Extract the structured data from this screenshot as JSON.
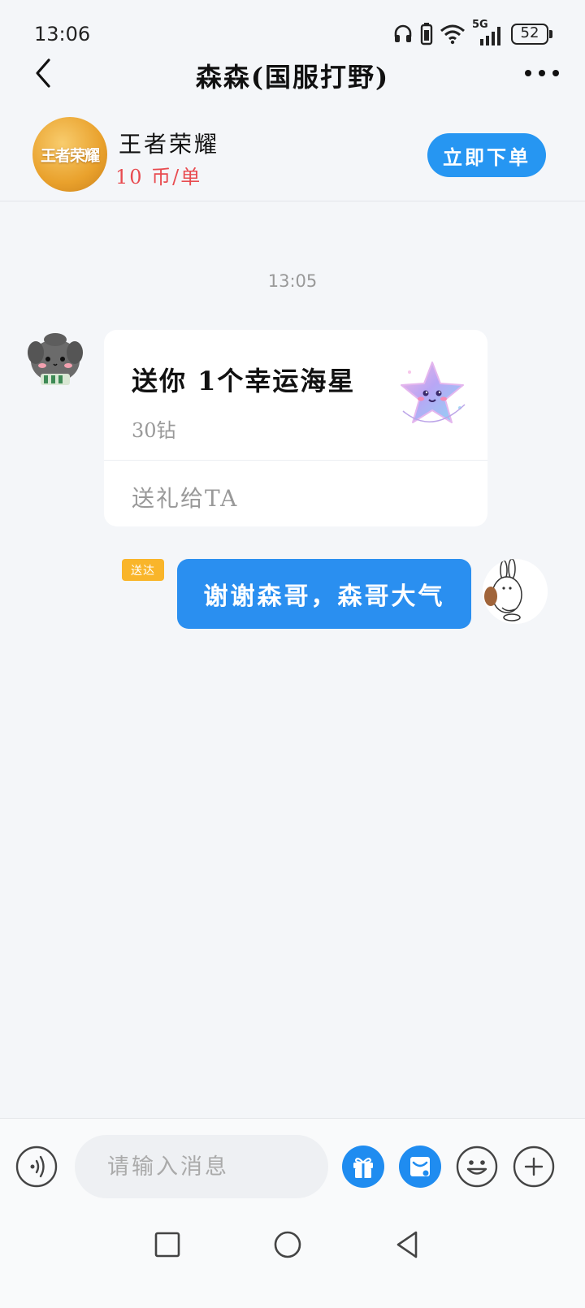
{
  "status_bar": {
    "time": "13:06",
    "battery_level": "52",
    "network_label": "5G"
  },
  "header": {
    "title": "森森(国服打野)"
  },
  "product": {
    "game_name": "王者荣耀",
    "price": "10 币/单",
    "logo_text": "王者荣耀",
    "order_button": "立即下单"
  },
  "chat": {
    "timestamp": "13:05",
    "gift_card": {
      "title": "送你 1个幸运海星",
      "price": "30钻",
      "action": "送礼给TA"
    },
    "sent_message": {
      "status": "送达",
      "text": "谢谢森哥，森哥大气"
    }
  },
  "input": {
    "placeholder": "请输入消息"
  },
  "colors": {
    "accent": "#2696f2",
    "price_red": "#e84b50",
    "badge_yellow": "#f9b52a",
    "background": "#f4f6f9"
  }
}
